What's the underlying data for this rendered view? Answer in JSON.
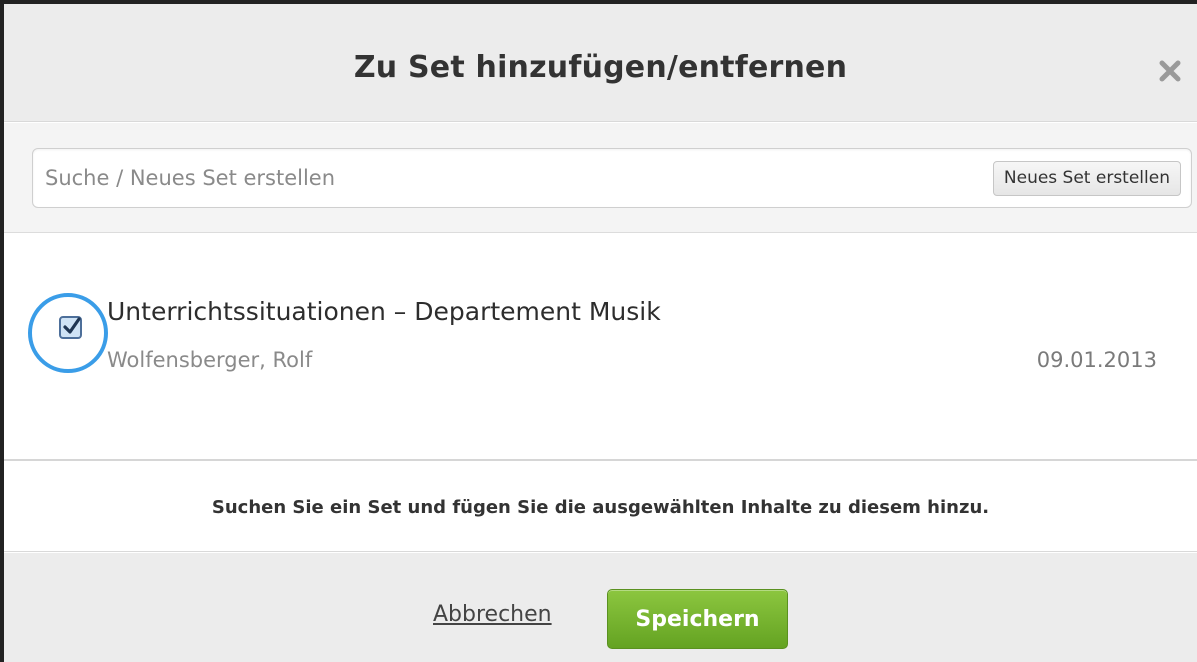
{
  "dialog": {
    "title": "Zu Set hinzufügen/entfernen",
    "close_icon": "close-icon"
  },
  "search": {
    "placeholder": "Suche / Neues Set erstellen",
    "value": "",
    "create_label": "Neues Set erstellen"
  },
  "sets": [
    {
      "title": "Unterrichtssituationen – Departement Musik",
      "owner": "Wolfensberger, Rolf",
      "date": "09.01.2013",
      "checked": true,
      "checkbox_icon": "checkmark-icon"
    }
  ],
  "hint": "Suchen Sie ein Set und fügen Sie die ausgewählten Inhalte zu diesem hinzu.",
  "footer": {
    "cancel_label": "Abbrechen",
    "save_label": "Speichern"
  },
  "colors": {
    "header_bg": "#ececec",
    "highlight_ring": "#3a9de8",
    "save_button": "#76b52e",
    "checkbox_fill": "#cfe3f5"
  }
}
